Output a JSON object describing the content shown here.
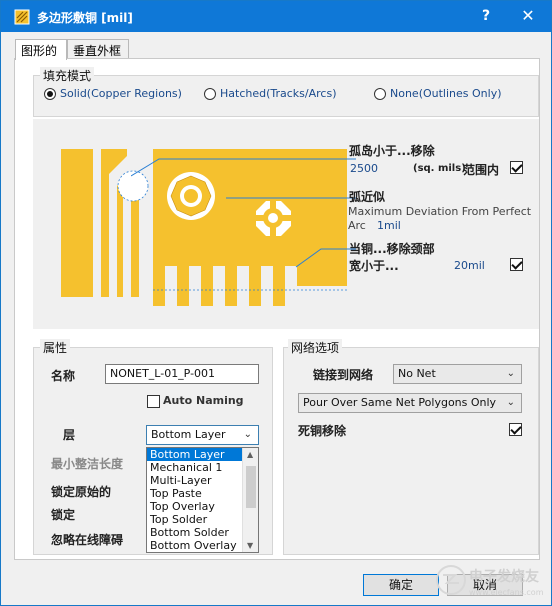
{
  "window": {
    "title": "多边形敷铜 [mil]",
    "help": "?",
    "close": "✕"
  },
  "tabs": [
    {
      "label": "图形的",
      "active": true
    },
    {
      "label": "垂直外框",
      "active": false
    }
  ],
  "fill_mode": {
    "title": "填充模式",
    "options": [
      {
        "label": "Solid(Copper Regions)",
        "selected": true
      },
      {
        "label": "Hatched(Tracks/Arcs)",
        "selected": false
      },
      {
        "label": "None(Outlines Only)",
        "selected": false
      }
    ]
  },
  "diagram": {
    "islands": {
      "label": "孤岛小于...移除",
      "value": "2500",
      "unit": "(sq. mils)",
      "scope_label": "范围内",
      "scope_checked": true
    },
    "arc": {
      "label": "弧近似",
      "desc_line1": "Maximum Deviation From Perfect",
      "desc_prefix": "Arc",
      "value": "1mil"
    },
    "necks": {
      "label_line1": "当铜...移除颈部",
      "label_line2": "宽小于...",
      "value": "20mil",
      "checked": true
    },
    "colors": {
      "copper": "#f5c12e",
      "copper_edge": "#e0a81a",
      "callout": "#2a7fd4"
    }
  },
  "properties": {
    "title": "属性",
    "name_label": "名称",
    "name_value": "NONET_L-01_P-001",
    "auto_naming_label": "Auto Naming",
    "auto_naming_checked": false,
    "layer_label": "层",
    "layer_value": "Bottom Layer",
    "min_prim_label": "最小整洁长度",
    "lock_prims_label": "锁定原始的",
    "locked_label": "锁定",
    "ignore_obstacles_label": "忽略在线障碍",
    "layer_options": [
      "Bottom Layer",
      "Mechanical 1",
      "Multi-Layer",
      "Top Paste",
      "Top Overlay",
      "Top Solder",
      "Bottom Solder",
      "Bottom Overlay"
    ]
  },
  "net_options": {
    "title": "网络选项",
    "connect_label": "链接到网络",
    "net_value": "No Net",
    "pour_value": "Pour Over Same Net Polygons Only",
    "remove_dead_label": "死铜移除",
    "remove_dead_checked": true
  },
  "buttons": {
    "ok": "确定",
    "cancel": "取消"
  },
  "watermark": {
    "text": "电子发烧友",
    "url": "www.elecfans.com"
  }
}
